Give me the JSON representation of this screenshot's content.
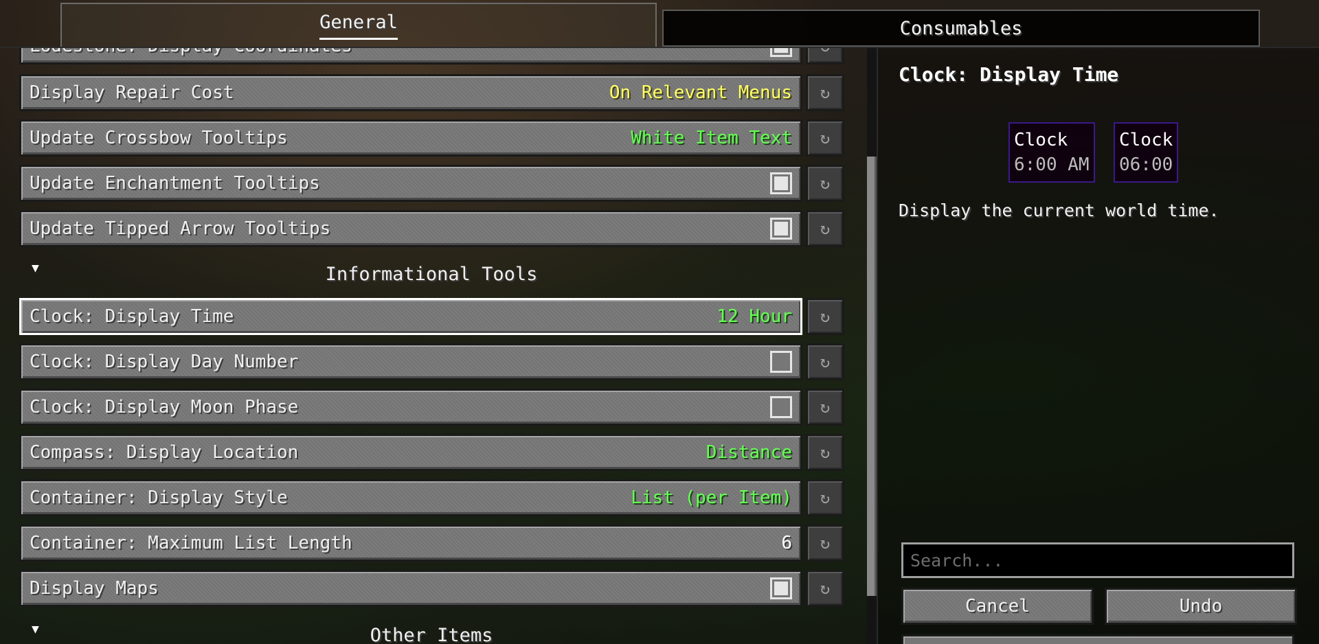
{
  "tabs": {
    "general": "General",
    "consumables": "Consumables"
  },
  "partial_row": {
    "name": "Lodestone: Display Coordinates",
    "checked": true
  },
  "rows": [
    {
      "name": "Display Repair Cost",
      "value": "On Relevant Menus",
      "color": "#ffff66"
    },
    {
      "name": "Update Crossbow Tooltips",
      "value": "White Item Text",
      "color": "#66ff55"
    },
    {
      "name": "Update Enchantment Tooltips",
      "checked": true
    },
    {
      "name": "Update Tipped Arrow Tooltips",
      "checked": true
    }
  ],
  "section_informational": "Informational Tools",
  "rows2": [
    {
      "name": "Clock: Display Time",
      "value": "12 Hour",
      "selected": true
    },
    {
      "name": "Clock: Display Day Number",
      "checked": false
    },
    {
      "name": "Clock: Display Moon Phase",
      "checked": false
    },
    {
      "name": "Compass: Display Location",
      "value": "Distance"
    },
    {
      "name": "Container: Display Style",
      "value": "List (per Item)"
    },
    {
      "name": "Container: Maximum List Length",
      "value": "6"
    },
    {
      "name": "Display Maps",
      "checked": true
    }
  ],
  "section_other": "Other Items",
  "reset_glyph": "↻",
  "collapse_glyph": "▼",
  "right_panel": {
    "title": "Clock: Display Time",
    "tooltips": [
      {
        "line1": "Clock",
        "line2": "6:00 AM"
      },
      {
        "line1": "Clock",
        "line2": "06:00"
      }
    ],
    "description": "Display the current world time.",
    "search_placeholder": "Search...",
    "cancel": "Cancel",
    "undo": "Undo"
  }
}
